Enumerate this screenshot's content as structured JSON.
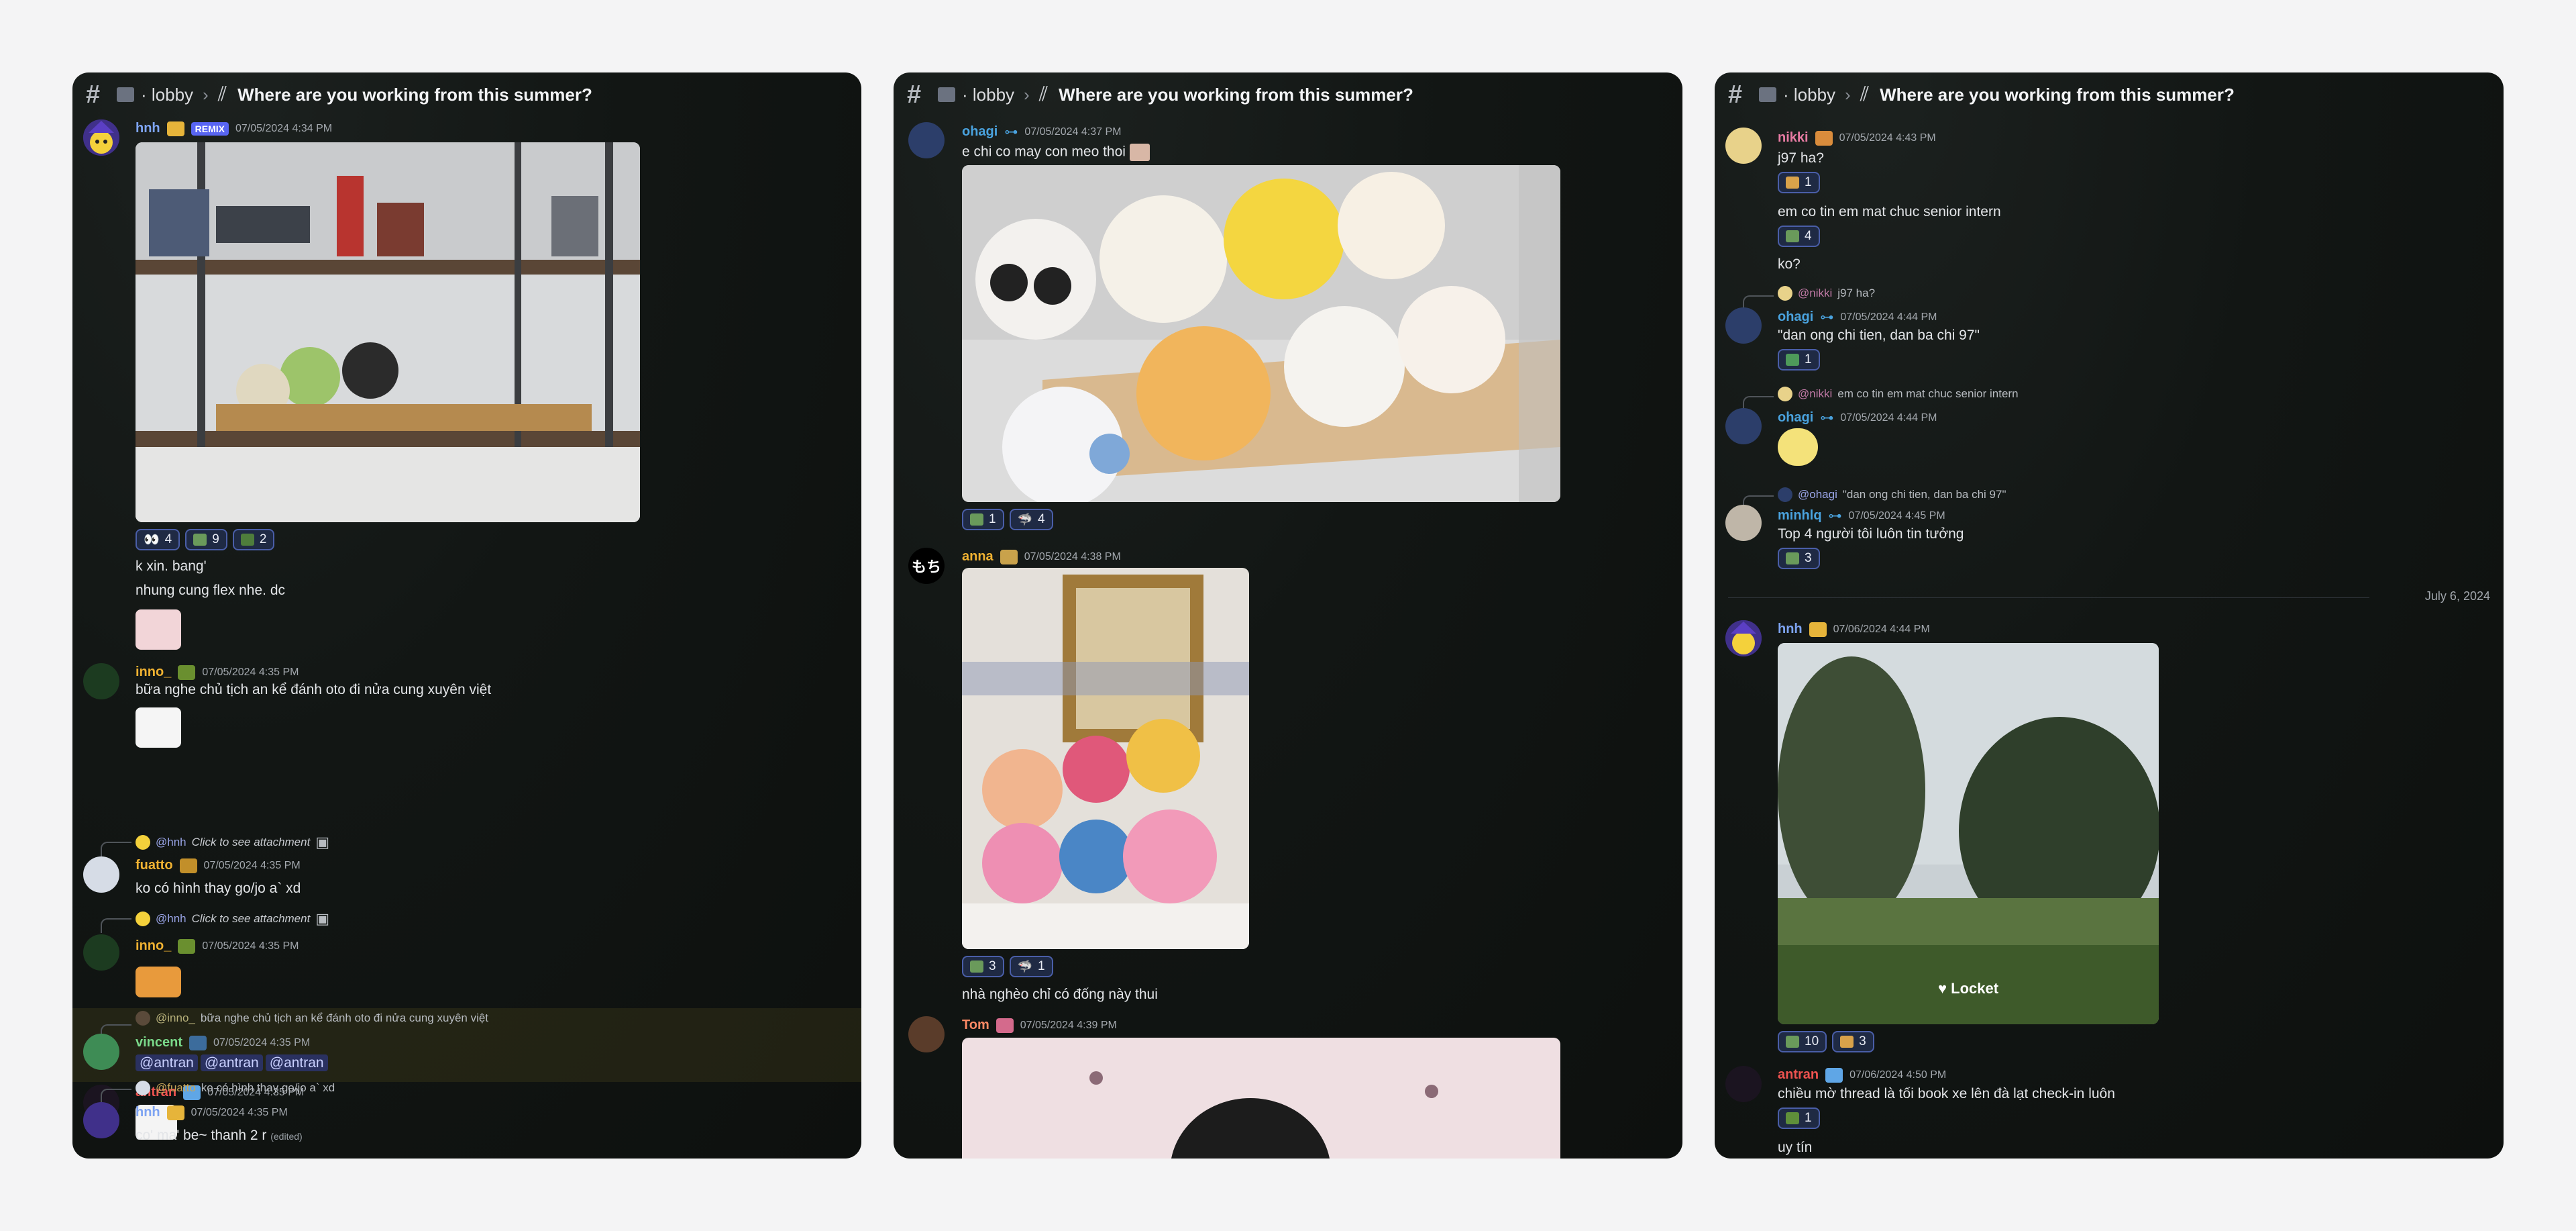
{
  "breadcrumb": {
    "channel": "lobby",
    "thread": "Where are you working from this summer?"
  },
  "panel1": {
    "m1": {
      "user": "hnh",
      "tag": "REMIX",
      "ts": "07/05/2024 4:34 PM",
      "reactions": [
        {
          "emoji": "eyes-icon",
          "count": "4"
        },
        {
          "emoji": "frog-icon",
          "count": "9"
        },
        {
          "emoji": "frog-hat-icon",
          "count": "2"
        }
      ],
      "text1": "k xin. bang'",
      "text2": "nhung cung flex nhe. dc"
    },
    "m2": {
      "user": "inno_",
      "ts": "07/05/2024 4:35 PM",
      "text": "bữa nghe chủ tịch an kể đánh oto đi nửa cung xuyên việt"
    },
    "m3": {
      "reply_mention": "@hnh",
      "reply_text": "Click to see attachment",
      "user": "fuatto",
      "ts": "07/05/2024 4:35 PM",
      "text": "ko có hình thay go/jo a` xd"
    },
    "m4": {
      "reply_mention": "@hnh",
      "reply_text": "Click to see attachment",
      "user": "inno_",
      "ts": "07/05/2024 4:35 PM"
    },
    "m5": {
      "reply_mention": "@inno_",
      "reply_text": "bữa nghe chủ tịch an kể đánh oto đi nửa cung xuyên việt",
      "user": "vincent",
      "ts": "07/05/2024 4:35 PM",
      "mentions": [
        "@antran",
        "@antran",
        "@antran"
      ]
    },
    "m6": {
      "user": "antran",
      "ts": "07/05/2024 4:35 PM"
    },
    "m7": {
      "reply_mention": "@fuatto",
      "reply_text": "ko có hình thay go/jo a` xd",
      "user": "hnh",
      "ts": "07/05/2024 4:35 PM",
      "text": "co' ma' be~ thanh 2 r",
      "edited": "(edited)"
    }
  },
  "panel2": {
    "m1": {
      "user": "ohagi",
      "ts": "07/05/2024 4:37 PM",
      "text": "e chi co may con meo thoi",
      "reactions": [
        {
          "emoji": "frog-icon",
          "count": "1"
        },
        {
          "emoji": "shark-icon",
          "count": "4"
        }
      ]
    },
    "m2": {
      "user": "anna",
      "avatar_text": "もち",
      "ts": "07/05/2024 4:38 PM",
      "reactions": [
        {
          "emoji": "frog-icon",
          "count": "3"
        },
        {
          "emoji": "shark-icon",
          "count": "1"
        }
      ],
      "text": "nhà nghèo chỉ có đống này thui"
    },
    "m3": {
      "user": "Tom",
      "ts": "07/05/2024 4:39 PM"
    }
  },
  "panel3": {
    "m1": {
      "user": "nikki",
      "ts": "07/05/2024 4:43 PM",
      "text": "j97 ha?",
      "react1": {
        "emoji": "thumb-icon",
        "count": "1"
      },
      "text2": "em co tin em mat chuc senior intern",
      "react2": {
        "emoji": "frog-icon",
        "count": "4"
      },
      "text3": "ko?"
    },
    "m2": {
      "reply_mention": "@nikki",
      "reply_text": "j97 ha?",
      "user": "ohagi",
      "ts": "07/05/2024 4:44 PM",
      "text": "\"dan ong chi tien, dan ba chi 97\"",
      "react": {
        "emoji": "money-icon",
        "count": "1"
      }
    },
    "m3": {
      "reply_mention": "@nikki",
      "reply_text": "em co tin em mat chuc senior intern",
      "user": "ohagi",
      "ts": "07/05/2024 4:44 PM"
    },
    "m4": {
      "reply_mention": "@ohagi",
      "reply_text": "\"dan ong chi tien, dan ba chi 97\"",
      "user": "minhlq",
      "ts": "07/05/2024 4:45 PM",
      "text": "Top 4 người tôi luôn tin tưởng",
      "react": {
        "emoji": "frog-icon",
        "count": "3"
      }
    },
    "date_divider": "July 6, 2024",
    "m5": {
      "user": "hnh",
      "ts": "07/06/2024 4:44 PM",
      "locket": "Locket",
      "reactions": [
        {
          "emoji": "frog-icon",
          "count": "10"
        },
        {
          "emoji": "thumb-icon",
          "count": "3"
        }
      ]
    },
    "m6": {
      "user": "antran",
      "ts": "07/06/2024 4:50 PM",
      "text": "chiều mờ thread là tối book xe lên đà lạt check-in luôn",
      "react": {
        "emoji": "check-icon",
        "count": "1"
      },
      "text2": "uy tín"
    }
  },
  "colors": {
    "bg": "#0f1311",
    "accent": "#5865f2",
    "reaction_bg": "#1f2a44",
    "reaction_border": "#4a5ea8",
    "user_hnh": "#7ea4f2",
    "user_orange": "#f0b232",
    "user_ohagi": "#4aa3df",
    "user_pink": "#e87ba3",
    "user_vincent": "#7ad98a",
    "user_red": "#ef5350",
    "user_tom": "#ff8a65"
  }
}
